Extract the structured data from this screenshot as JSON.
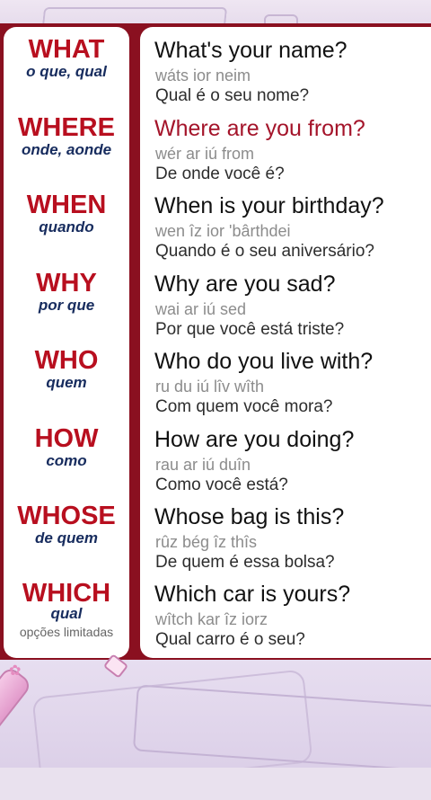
{
  "rows": [
    {
      "word": "WHAT",
      "translation": "o que, qual",
      "question": "What's your name?",
      "pronunciation": "wáts ior neim",
      "portuguese": "Qual é o seu nome?"
    },
    {
      "word": "WHERE",
      "translation": "onde, aonde",
      "question": "Where are you from?",
      "pronunciation": "wér ar iú from",
      "portuguese": "De onde você é?"
    },
    {
      "word": "WHEN",
      "translation": "quando",
      "question": "When is your birthday?",
      "pronunciation": "wen îz ior 'bârthdei",
      "portuguese": "Quando é o seu aniversário?"
    },
    {
      "word": "WHY",
      "translation": "por que",
      "question": "Why are you sad?",
      "pronunciation": "wai ar iú sed",
      "portuguese": "Por que você está triste?"
    },
    {
      "word": "WHO",
      "translation": "quem",
      "question": "Who do you live with?",
      "pronunciation": "ru du iú lîv wîth",
      "portuguese": "Com quem você mora?"
    },
    {
      "word": "HOW",
      "translation": "como",
      "question": "How are you doing?",
      "pronunciation": "rau ar iú duîn",
      "portuguese": "Como você está?"
    },
    {
      "word": "WHOSE",
      "translation": "de quem",
      "question": "Whose bag is this?",
      "pronunciation": "rûz bég îz thîs",
      "portuguese": "De quem é essa bolsa?"
    },
    {
      "word": "WHICH",
      "translation": "qual",
      "note": "opções limitadas",
      "question": "Which car is yours?",
      "pronunciation": "wîtch kar îz iorz",
      "portuguese": "Qual carro é o seu?"
    }
  ],
  "colors": {
    "accent_red": "#b80f1f",
    "board": "#8a1020",
    "translation_navy": "#172c5e"
  },
  "icons": [
    "flower-icon",
    "pen-icon"
  ]
}
